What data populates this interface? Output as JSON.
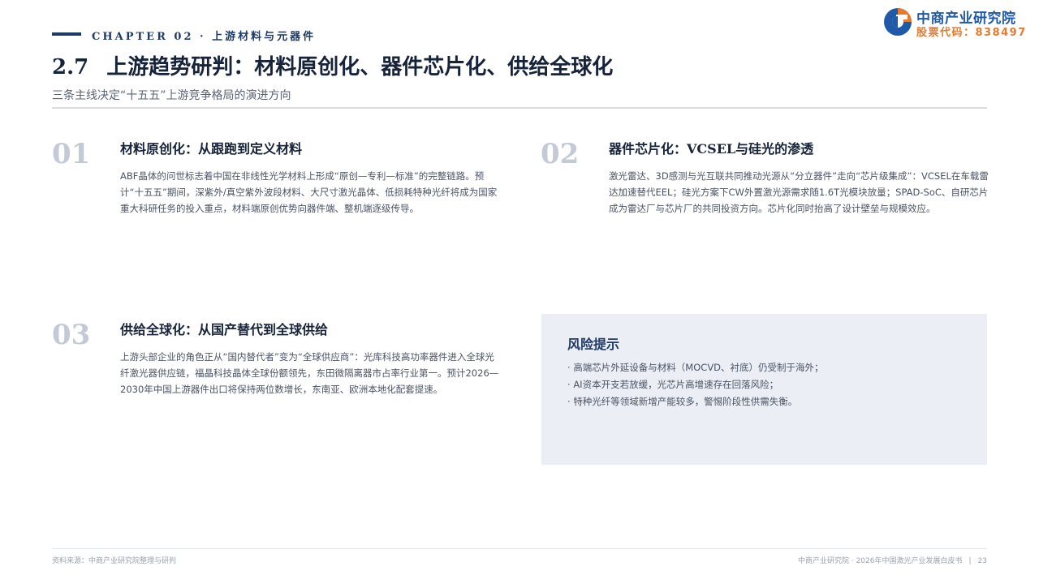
{
  "header": {
    "chapter": "CHAPTER 02 · 上游材料与元器件"
  },
  "logo": {
    "name": "中商产业研究院",
    "code": "股票代码：838497",
    "icon": "company-logo-mark",
    "colors": {
      "blue": "#1f5aa8",
      "orange": "#e87a2c"
    }
  },
  "page": {
    "section_number": "2.7",
    "title": "上游趋势研判：材料原创化、器件芯片化、供给全球化",
    "subtitle": "三条主线决定“十五五”上游竞争格局的演进方向"
  },
  "blocks": [
    {
      "number": "01",
      "heading": "材料原创化：从跟跑到定义材料",
      "text": "ABF晶体的问世标志着中国在非线性光学材料上形成“原创—专利—标准”的完整链路。预计“十五五”期间，深紫外/真空紫外波段材料、大尺寸激光晶体、低损耗特种光纤将成为国家重大科研任务的投入重点，材料端原创优势向器件端、整机端逐级传导。"
    },
    {
      "number": "02",
      "heading": "器件芯片化：VCSEL与硅光的渗透",
      "text": "激光雷达、3D感测与光互联共同推动光源从“分立器件”走向“芯片级集成”：VCSEL在车载雷达加速替代EEL；硅光方案下CW外置激光源需求随1.6T光模块放量；SPAD-SoC、自研芯片成为雷达厂与芯片厂的共同投资方向。芯片化同时抬高了设计壁垒与规模效应。"
    },
    {
      "number": "03",
      "heading": "供给全球化：从国产替代到全球供给",
      "text": "上游头部企业的角色正从“国内替代者”变为“全球供应商”：光库科技高功率器件进入全球光纤激光器供应链，福晶科技晶体全球份额领先，东田微隔离器市占率行业第一。预计2026—2030年中国上游器件出口将保持两位数增长，东南亚、欧洲本地化配套提速。"
    }
  ],
  "risk": {
    "title": "风险提示",
    "items": [
      "高端芯片外延设备与材料（MOCVD、衬底）仍受制于海外；",
      "AI资本开支若放缓，光芯片高增速存在回落风险；",
      "特种光纤等领域新增产能较多，警惕阶段性供需失衡。"
    ]
  },
  "footer": {
    "source": "资料来源：中商产业研究院整理与研判",
    "doc": "中商产业研究院 · 2026年中国激光产业发展白皮书",
    "separator": "|",
    "page": "23"
  }
}
